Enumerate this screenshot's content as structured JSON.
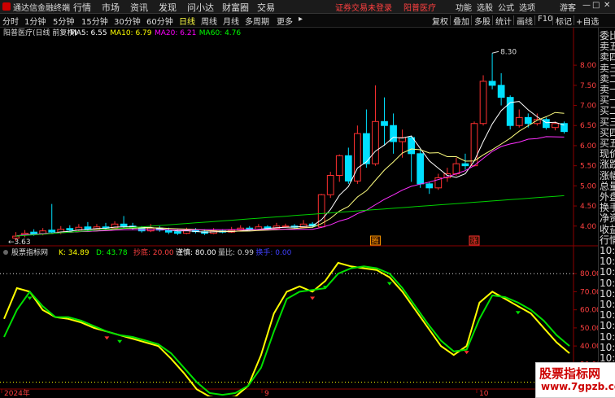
{
  "app": {
    "title": "通达信金融终端"
  },
  "menu": {
    "items": [
      "行情",
      "市场",
      "资讯",
      "发现",
      "问小达",
      "财富圈",
      "交易"
    ],
    "security_notice": "证券交易未登录",
    "stock_name": "阳普医疗",
    "right_items": [
      "功能",
      "选股",
      "公式",
      "选项"
    ],
    "guest": "游客"
  },
  "toolbar": {
    "periods": [
      "分时",
      "1分钟",
      "5分钟",
      "15分钟",
      "30分钟",
      "60分钟",
      "日线",
      "周线",
      "月线",
      "多周期",
      "更多"
    ],
    "active_period": "日线",
    "right_buttons": [
      "复权",
      "叠加",
      "多股",
      "统计",
      "画线",
      "F10",
      "标记",
      "+自选"
    ]
  },
  "main_chart": {
    "header_label": "阳普医疗(日线 前复权)",
    "ma": [
      {
        "name": "MA5",
        "value": "6.55",
        "color": "#ffffff"
      },
      {
        "name": "MA10",
        "value": "6.79",
        "color": "#ffff00"
      },
      {
        "name": "MA20",
        "value": "6.21",
        "color": "#ff00ff"
      },
      {
        "name": "MA60",
        "value": "4.76",
        "color": "#00ff00"
      }
    ],
    "high_label": "8.30",
    "low_label": "3.63",
    "badges": [
      "腾",
      "涨"
    ]
  },
  "sub_chart": {
    "header_label": "股票指标网",
    "values": [
      {
        "name": "K",
        "value": "34.89",
        "color": "#ffff00"
      },
      {
        "name": "D",
        "value": "43.78",
        "color": "#00ff00"
      },
      {
        "name": "抄底",
        "value": "20.00",
        "color": "#ff4040"
      },
      {
        "name": "谨慎",
        "value": "80.00",
        "color": "#ffffff"
      },
      {
        "name": "量比",
        "value": "0.99",
        "color": "#cccccc"
      },
      {
        "name": "换手",
        "value": "0.00",
        "color": "#4040ff"
      }
    ]
  },
  "date_axis": {
    "labels": [
      "2024年",
      "9",
      "10"
    ]
  },
  "sidebar": {
    "items": [
      "委比",
      "卖五",
      "卖四",
      "卖三",
      "卖二",
      "卖一",
      "买一",
      "买二",
      "买三",
      "买四",
      "买五",
      "现价",
      "涨跌",
      "涨幅",
      "总量",
      "外盘",
      "换手",
      "净资",
      "收益",
      "行情",
      "10:0",
      "10:0",
      "10:0",
      "10:0",
      "10:0",
      "10:0",
      "10:0",
      "10:0",
      "10:0",
      "10:0",
      "10:0",
      "10:0",
      "10:0"
    ]
  },
  "watermark": {
    "title": "股票指标网",
    "url": "www.7gpzb.com"
  },
  "chart_data": [
    {
      "type": "candlestick",
      "title": "阳普医疗(日线 前复权)",
      "y_ticks": [
        4.0,
        4.5,
        5.0,
        5.5,
        6.0,
        6.5,
        7.0,
        7.5,
        8.0
      ],
      "ylim": [
        3.55,
        8.65
      ],
      "candles": [
        [
          3.7,
          3.75,
          3.85,
          3.63
        ],
        [
          3.78,
          3.82,
          3.9,
          3.72
        ],
        [
          3.85,
          3.8,
          3.92,
          3.76
        ],
        [
          3.8,
          3.88,
          3.95,
          3.77
        ],
        [
          3.9,
          3.85,
          4.55,
          3.82
        ],
        [
          3.85,
          3.92,
          4.0,
          3.8
        ],
        [
          3.94,
          3.9,
          4.02,
          3.86
        ],
        [
          3.9,
          3.97,
          4.05,
          3.87
        ],
        [
          3.98,
          3.92,
          4.1,
          3.88
        ],
        [
          3.92,
          3.98,
          4.05,
          3.88
        ],
        [
          3.98,
          3.95,
          4.08,
          3.9
        ],
        [
          3.95,
          4.05,
          4.12,
          3.92
        ],
        [
          4.05,
          4.0,
          4.25,
          3.95
        ],
        [
          4.0,
          3.95,
          4.08,
          3.9
        ],
        [
          3.95,
          3.88,
          4.0,
          3.84
        ],
        [
          3.88,
          3.95,
          4.05,
          3.85
        ],
        [
          3.95,
          3.9,
          4.0,
          3.86
        ],
        [
          3.9,
          3.85,
          3.96,
          3.8
        ],
        [
          3.86,
          3.82,
          3.92,
          3.78
        ],
        [
          3.82,
          3.9,
          3.96,
          3.8
        ],
        [
          3.9,
          3.86,
          3.95,
          3.82
        ],
        [
          3.86,
          3.82,
          3.92,
          3.78
        ],
        [
          3.82,
          3.88,
          3.95,
          3.8
        ],
        [
          3.88,
          3.85,
          3.92,
          3.82
        ],
        [
          3.85,
          3.9,
          3.98,
          3.83
        ],
        [
          3.9,
          3.95,
          4.02,
          3.87
        ],
        [
          3.95,
          3.92,
          4.0,
          3.88
        ],
        [
          3.92,
          3.98,
          4.05,
          3.9
        ],
        [
          3.98,
          3.94,
          4.02,
          3.9
        ],
        [
          3.94,
          4.0,
          4.08,
          3.92
        ],
        [
          4.0,
          4.0,
          4.06,
          3.96
        ],
        [
          4.0,
          3.97,
          4.05,
          3.93
        ],
        [
          3.97,
          4.05,
          4.15,
          3.95
        ],
        [
          4.05,
          4.0,
          4.1,
          3.96
        ],
        [
          3.98,
          4.78,
          4.8,
          3.96
        ],
        [
          4.78,
          5.26,
          5.35,
          4.7
        ],
        [
          5.26,
          5.75,
          5.78,
          5.1
        ],
        [
          5.75,
          5.12,
          5.95,
          5.05
        ],
        [
          5.12,
          6.3,
          6.5,
          5.05
        ],
        [
          6.3,
          5.55,
          6.9,
          5.45
        ],
        [
          5.55,
          6.6,
          7.5,
          5.5
        ],
        [
          6.6,
          6.5,
          7.2,
          6.0
        ],
        [
          6.5,
          6.1,
          6.8,
          5.8
        ],
        [
          6.1,
          6.2,
          6.4,
          5.7
        ],
        [
          6.2,
          5.8,
          6.25,
          5.1
        ],
        [
          5.8,
          5.05,
          5.9,
          4.95
        ],
        [
          5.05,
          4.95,
          5.1,
          4.8
        ],
        [
          4.95,
          5.2,
          5.3,
          4.9
        ],
        [
          5.2,
          5.3,
          5.45,
          5.1
        ],
        [
          5.3,
          5.55,
          5.7,
          5.25
        ],
        [
          5.55,
          5.5,
          5.8,
          5.4
        ],
        [
          5.5,
          6.55,
          6.6,
          5.48
        ],
        [
          6.55,
          7.6,
          7.75,
          6.5
        ],
        [
          7.6,
          7.5,
          8.3,
          7.4
        ],
        [
          7.5,
          7.2,
          7.8,
          7.0
        ],
        [
          7.2,
          6.5,
          7.25,
          6.4
        ],
        [
          6.5,
          6.7,
          6.9,
          6.45
        ],
        [
          6.7,
          6.55,
          6.8,
          6.45
        ],
        [
          6.55,
          6.65,
          6.8,
          6.5
        ],
        [
          6.65,
          6.45,
          6.7,
          6.4
        ],
        [
          6.45,
          6.55,
          6.6,
          6.38
        ],
        [
          6.55,
          6.35,
          6.6,
          6.3
        ]
      ]
    },
    {
      "type": "line",
      "title": "股票指标网",
      "y_ticks": [
        30,
        40,
        50,
        60,
        70,
        80
      ],
      "ylim": [
        18,
        90
      ],
      "series": [
        {
          "name": "K",
          "values": [
            55,
            72,
            70,
            60,
            56,
            55,
            53,
            50,
            48,
            46,
            44,
            42,
            40,
            33,
            25,
            16,
            12,
            11,
            12,
            18,
            35,
            58,
            70,
            73,
            70,
            76,
            86,
            84,
            83,
            82,
            78,
            70,
            60,
            50,
            40,
            35,
            40,
            64,
            70,
            66,
            62,
            58,
            50,
            42,
            36
          ]
        },
        {
          "name": "D",
          "values": [
            45,
            60,
            70,
            62,
            56,
            56,
            54,
            51,
            48,
            46,
            45,
            43,
            41,
            36,
            28,
            20,
            14,
            13,
            14,
            18,
            28,
            48,
            66,
            70,
            71,
            72,
            80,
            83,
            84,
            83,
            80,
            72,
            62,
            52,
            43,
            37,
            38,
            55,
            68,
            67,
            64,
            60,
            54,
            46,
            40
          ]
        }
      ]
    }
  ]
}
